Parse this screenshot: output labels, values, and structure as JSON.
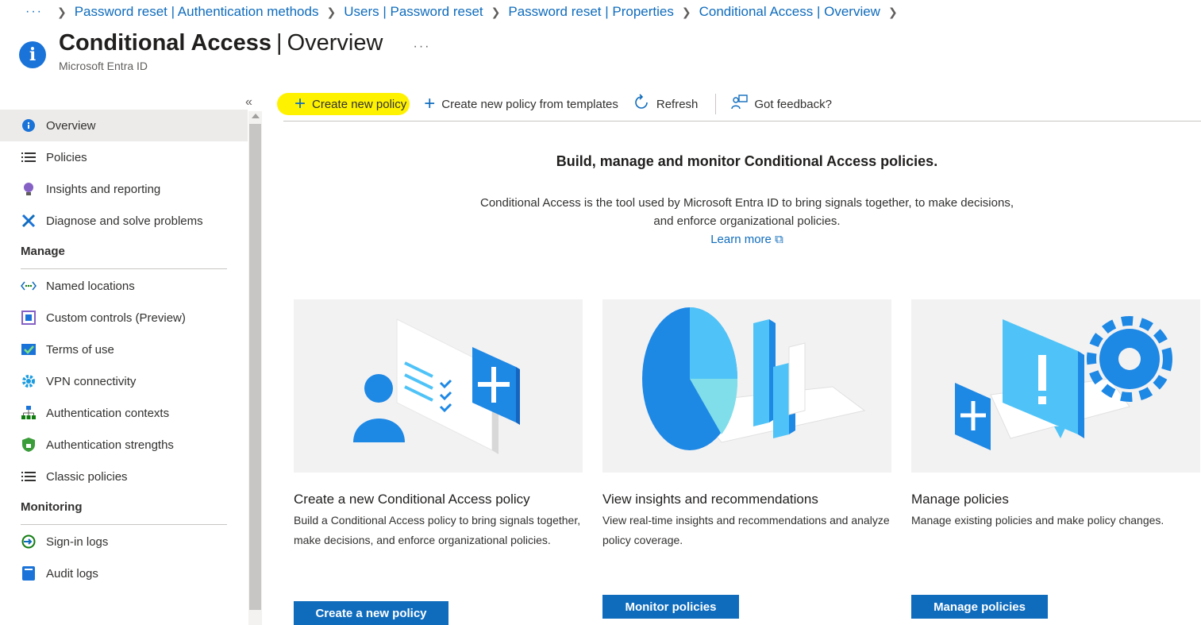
{
  "breadcrumb": {
    "more": "···",
    "items": [
      "Password reset | Authentication methods",
      "Users | Password reset",
      "Password reset | Properties",
      "Conditional Access | Overview"
    ]
  },
  "header": {
    "title_main": "Conditional Access",
    "title_sep": "|",
    "title_sub": "Overview",
    "subtitle": "Microsoft Entra ID",
    "more": "···"
  },
  "sidebar": {
    "collapse": "«",
    "items": [
      {
        "label": "Overview",
        "icon": "info-icon"
      },
      {
        "label": "Policies",
        "icon": "list-icon"
      },
      {
        "label": "Insights and reporting",
        "icon": "lightbulb-icon"
      },
      {
        "label": "Diagnose and solve problems",
        "icon": "tools-icon"
      }
    ],
    "manage_title": "Manage",
    "manage_items": [
      {
        "label": "Named locations",
        "icon": "location-icon"
      },
      {
        "label": "Custom controls (Preview)",
        "icon": "custom-controls-icon"
      },
      {
        "label": "Terms of use",
        "icon": "checklist-icon"
      },
      {
        "label": "VPN connectivity",
        "icon": "gear-icon"
      },
      {
        "label": "Authentication contexts",
        "icon": "hierarchy-icon"
      },
      {
        "label": "Authentication strengths",
        "icon": "shield-icon"
      },
      {
        "label": "Classic policies",
        "icon": "list-icon"
      }
    ],
    "monitoring_title": "Monitoring",
    "monitoring_items": [
      {
        "label": "Sign-in logs",
        "icon": "signin-icon"
      },
      {
        "label": "Audit logs",
        "icon": "book-icon"
      }
    ]
  },
  "toolbar": {
    "create_new": "Create new policy",
    "from_templates": "Create new policy from templates",
    "refresh": "Refresh",
    "feedback": "Got feedback?"
  },
  "intro": {
    "heading": "Build, manage and monitor Conditional Access policies.",
    "line1": "Conditional Access is the tool used by Microsoft Entra ID to bring signals together, to make decisions,",
    "line2": "and enforce organizational policies.",
    "learn_more": "Learn more"
  },
  "cards": [
    {
      "title": "Create a new Conditional Access policy",
      "desc": "Build a Conditional Access policy to bring signals together, make decisions, and enforce organizational policies.",
      "button": "Create a new policy"
    },
    {
      "title": "View insights and recommendations",
      "desc": "View real-time insights and recommendations and analyze policy coverage.",
      "button": "Monitor policies"
    },
    {
      "title": "Manage policies",
      "desc": "Manage existing policies and make policy changes.",
      "button": "Manage policies"
    }
  ],
  "colors": {
    "accent": "#0f6cbd",
    "highlight": "#fff200",
    "illustration_blue": "#1e88e5"
  }
}
